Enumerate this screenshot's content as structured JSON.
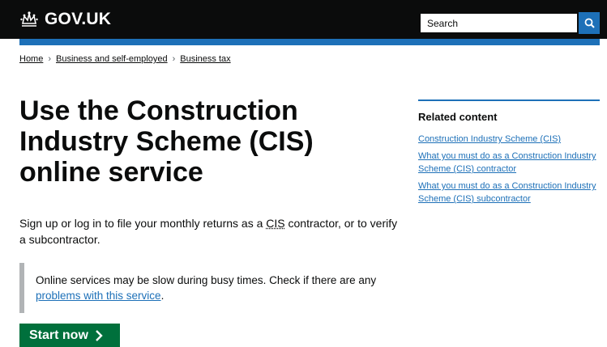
{
  "header": {
    "logo_text": "GOV.UK",
    "search_placeholder": "Search"
  },
  "breadcrumb": [
    "Home",
    "Business and self-employed",
    "Business tax"
  ],
  "main": {
    "title": "Use the Construction Industry Scheme (CIS) online service",
    "lead": {
      "before": "Sign up or log in to file your monthly returns as a ",
      "abbr": "CIS",
      "after": " contractor, or to verify a subcontractor."
    },
    "inset": {
      "text": "Online services may be slow during busy times. Check if there are any ",
      "link": "problems with this service",
      "after": "."
    },
    "start_button": "Start now"
  },
  "related": {
    "heading": "Related content",
    "links": [
      "Construction Industry Scheme (CIS)",
      "What you must do as a Construction Industry Scheme (CIS) contractor",
      "What you must do as a Construction Industry Scheme (CIS) subcontractor"
    ]
  },
  "colors": {
    "header_bg": "#0b0c0c",
    "brand_blue": "#1d70b8",
    "start_green": "#00703c",
    "inset_border": "#b1b4b6"
  }
}
